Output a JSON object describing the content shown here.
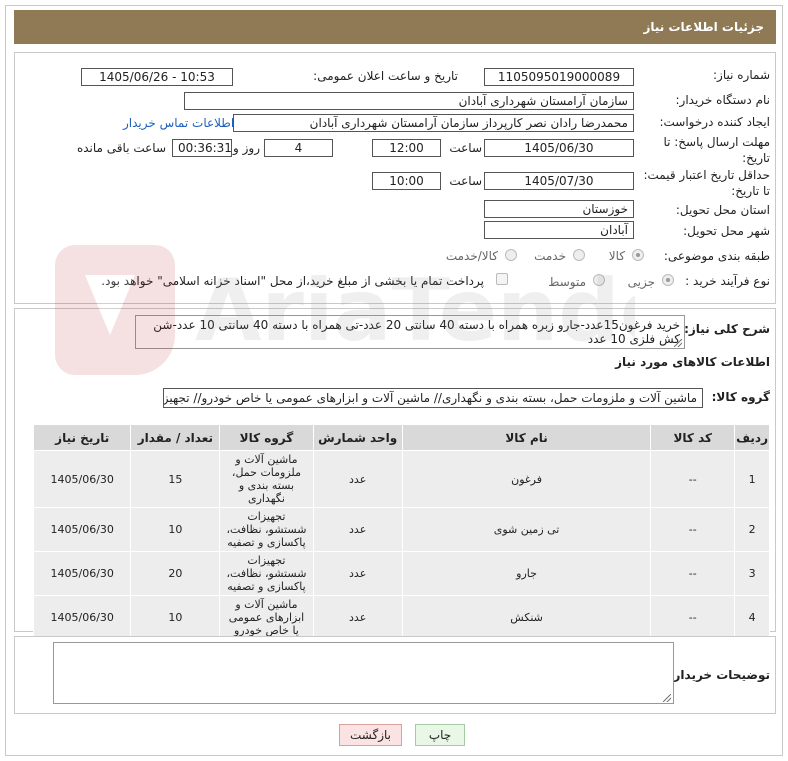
{
  "header": {
    "title": "جزئیات اطلاعات نیاز"
  },
  "form": {
    "need_number_label": "شماره نیاز:",
    "need_number": "1105095019000089",
    "announce_label": "تاریخ و ساعت اعلان عمومی:",
    "announce_value": "1405/06/26 - 10:53",
    "buyer_org_label": "نام دستگاه خریدار:",
    "buyer_org": "سازمان آرامستان شهرداری آبادان",
    "creator_label": "ایجاد کننده درخواست:",
    "creator": "محمدرضا رادان نصر کارپرداز سازمان آرامستان شهرداری آبادان",
    "contact_link": "اطلاعات تماس خریدار",
    "deadline_label_1": "مهلت ارسال پاسخ: تا",
    "deadline_label_2": "تاریخ:",
    "deadline_date": "1405/06/30",
    "time_label": "ساعت",
    "deadline_time": "12:00",
    "days_value": "4",
    "days_label": "روز و",
    "remaining_time": "00:36:31",
    "remaining_label": "ساعت باقی مانده",
    "price_validity_label_1": "حداقل تاریخ اعتبار قیمت:",
    "price_validity_label_2": "تا تاریخ:",
    "price_validity_date": "1405/07/30",
    "price_validity_time": "10:00",
    "province_label": "استان محل تحویل:",
    "province": "خوزستان",
    "city_label": "شهر محل تحویل:",
    "city": "آبادان",
    "category_label": "طبقه بندی موضوعی:",
    "category_options": [
      "کالا",
      "خدمت",
      "کالا/خدمت"
    ],
    "category_selected": "کالا",
    "process_label": "نوع فرآیند خرید :",
    "process_options": [
      "جزیی",
      "متوسط"
    ],
    "process_selected": "جزیی",
    "treasury_note": "پرداخت تمام یا بخشی از مبلغ خرید،از محل \"اسناد خزانه اسلامی\" خواهد بود."
  },
  "description": {
    "label": "شرح کلی نیاز:",
    "text": "خرید فرغون15عدد-جارو زبره همراه با دسته 40 سانتی 20 عدد-تی همراه با دسته 40 سانتی 10 عدد-شن کش فلزی 10 عدد"
  },
  "goods": {
    "section_title": "اطلاعات کالاهای مورد نیاز",
    "group_label": "گروه کالا:",
    "group_value": "ماشین آلات و ملزومات حمل، بسته بندی و نگهداری//  ماشین آلات و ابزارهای عمومی یا خاص خودرو// تجهیزا",
    "columns": [
      "ردیف",
      "کد کالا",
      "نام کالا",
      "واحد شمارش",
      "گروه کالا",
      "تعداد / مقدار",
      "تاریخ نیاز"
    ],
    "rows": [
      {
        "row": "1",
        "code": "--",
        "name": "فرغون",
        "unit": "عدد",
        "group": "ماشین آلات و ملزومات حمل، بسته بندی و نگهداری",
        "qty": "15",
        "date": "1405/06/30"
      },
      {
        "row": "2",
        "code": "--",
        "name": "تی زمین شوی",
        "unit": "عدد",
        "group": "تجهیزات شستشو، نظافت، پاکسازی و تصفیه",
        "qty": "10",
        "date": "1405/06/30"
      },
      {
        "row": "3",
        "code": "--",
        "name": "جارو",
        "unit": "عدد",
        "group": "تجهیزات شستشو، نظافت، پاکسازی و تصفیه",
        "qty": "20",
        "date": "1405/06/30"
      },
      {
        "row": "4",
        "code": "--",
        "name": "شنکش",
        "unit": "عدد",
        "group": "ماشین آلات و ابزارهای عمومی یا خاص خودرو",
        "qty": "10",
        "date": "1405/06/30"
      }
    ]
  },
  "buyer_notes": {
    "label": "توضیحات خریدار:",
    "text": ""
  },
  "buttons": {
    "print": "چاپ",
    "back": "بازگشت"
  },
  "watermark": {
    "text": "AriaTender.net"
  },
  "colors": {
    "title_bg": "#8f7a55",
    "link": "#1f5fbf",
    "back_btn_bg": "#fbe3e3",
    "print_btn_bg": "#e8f7e6"
  }
}
